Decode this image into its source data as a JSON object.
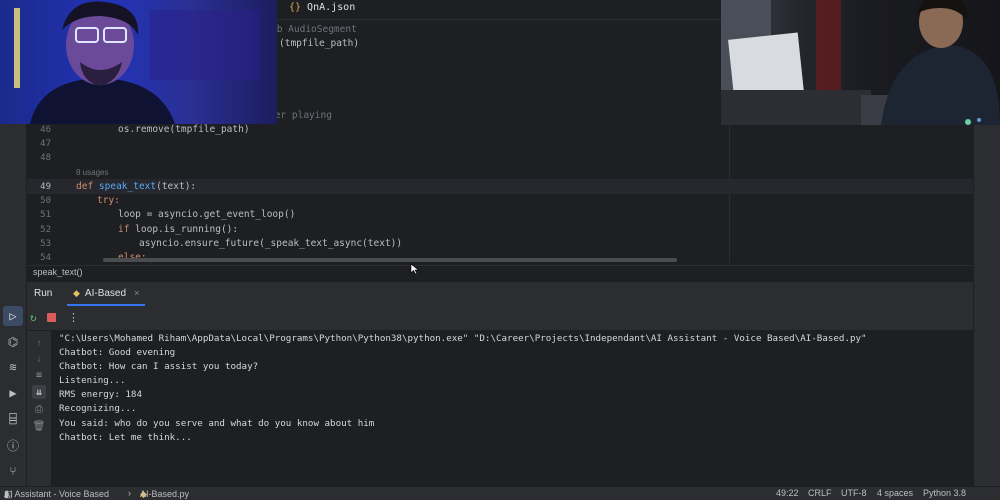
{
  "editor": {
    "tab_filename": "QnA.json",
    "partial_lines": {
      "l1": "ub AudioSegment",
      "l2": "(tmpfile_path)",
      "l3": "cer playing"
    },
    "line_numbers": [
      "46",
      "47",
      "48",
      "49",
      "50",
      "51",
      "52",
      "53",
      "54"
    ],
    "usages_hint": "8 usages",
    "code": {
      "l46": "os.remove(tmpfile_path)",
      "l49_def": "def",
      "l49_fn": "speak_text",
      "l49_rest": "(text):",
      "l50": "try:",
      "l51": "loop = asyncio.get_event_loop()",
      "l52_kw": "if",
      "l52_rest": " loop.is_running():",
      "l53": "asyncio.ensure_future(_speak_text_async(text))",
      "l54": "else:"
    }
  },
  "breadcrumb": "speak_text()",
  "run_panel": {
    "title": "Run",
    "tab_label": "AI-Based",
    "close_glyph": "×"
  },
  "console": {
    "lines": [
      "\"C:\\Users\\Mohamed Riham\\AppData\\Local\\Programs\\Python\\Python38\\python.exe\" \"D:\\Career\\Projects\\Independant\\AI Assistant - Voice Based\\AI-Based.py\"",
      "Chatbot: Good evening",
      "Chatbot: How can I assist you today?",
      "Listening...",
      "RMS energy: 184",
      "Recognizing...",
      "You said: who do you serve and what do you know about him",
      "Chatbot: Let me think..."
    ]
  },
  "status_bar": {
    "project": "AI Assistant - Voice Based",
    "file": "AI-Based.py",
    "position": "49:22",
    "line_ending": "CRLF",
    "encoding": "UTF-8",
    "indent": "4 spaces",
    "interpreter": "Python 3.8"
  },
  "colors": {
    "accent": "#3574f0",
    "keyword": "#cf8e6d",
    "function": "#56a8f5",
    "stop": "#db5c5c",
    "rerun": "#5fb865"
  }
}
